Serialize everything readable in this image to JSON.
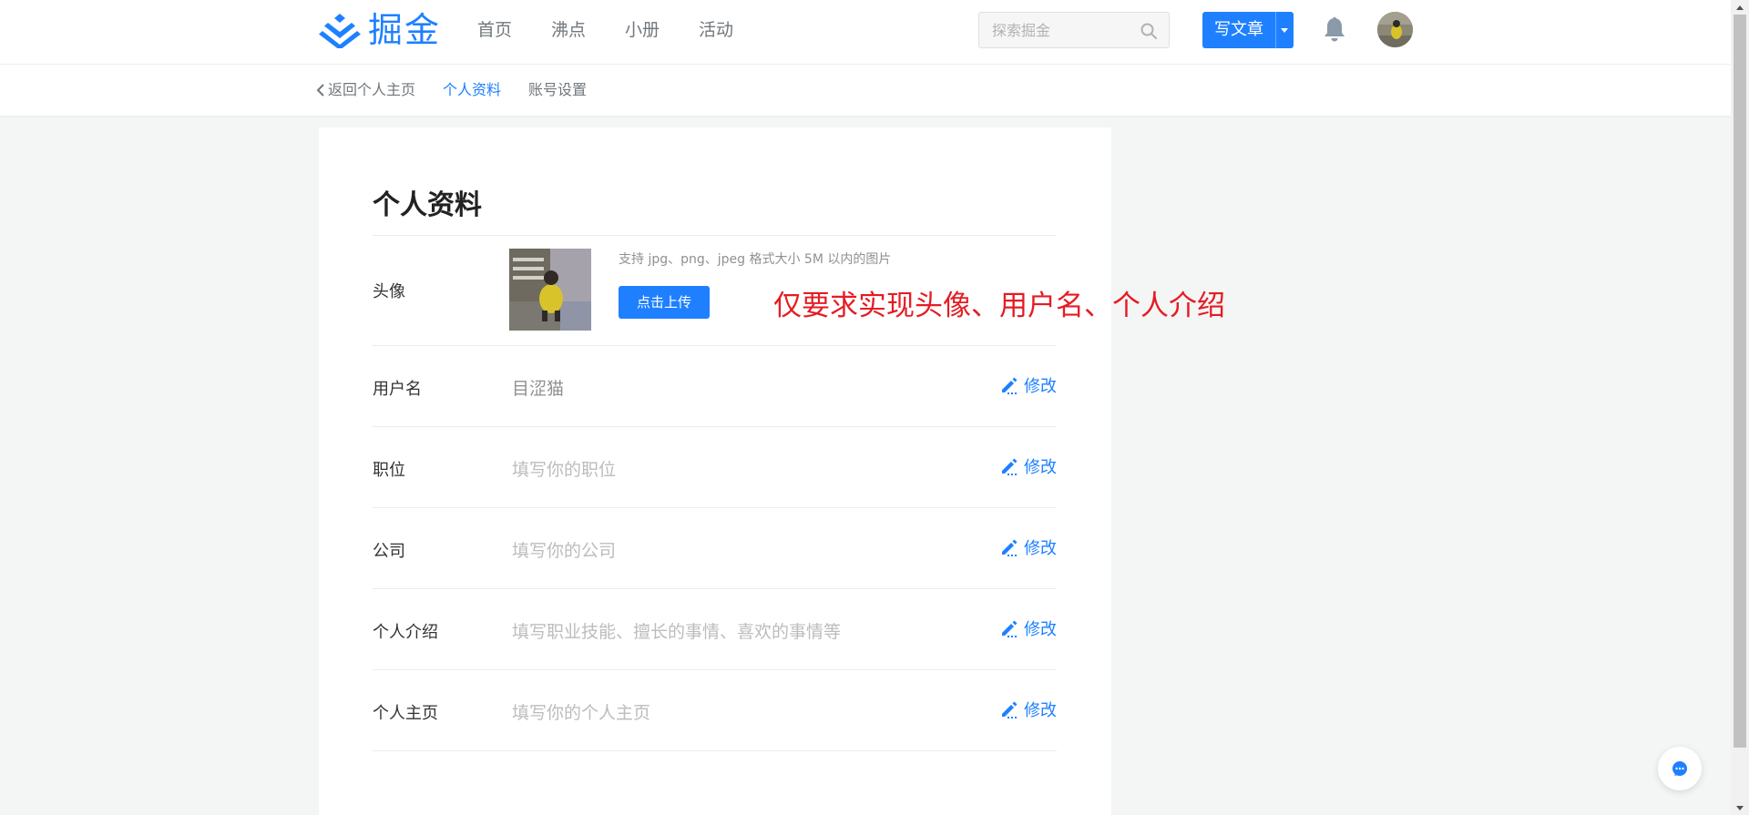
{
  "header": {
    "logo_text": "掘金",
    "nav": [
      "首页",
      "沸点",
      "小册",
      "活动"
    ],
    "search_placeholder": "探索掘金",
    "write_label": "写文章"
  },
  "subnav": {
    "back": "返回个人主页",
    "profile": "个人资料",
    "account": "账号设置"
  },
  "profile": {
    "title": "个人资料",
    "avatar_label": "头像",
    "upload_tip": "支持 jpg、png、jpeg 格式大小 5M 以内的图片",
    "upload_button": "点击上传",
    "rows": [
      {
        "label": "用户名",
        "value": "目涩猫",
        "placeholder": false,
        "action": "修改"
      },
      {
        "label": "职位",
        "value": "填写你的职位",
        "placeholder": true,
        "action": "修改"
      },
      {
        "label": "公司",
        "value": "填写你的公司",
        "placeholder": true,
        "action": "修改"
      },
      {
        "label": "个人介绍",
        "value": "填写职业技能、擅长的事情、喜欢的事情等",
        "placeholder": true,
        "action": "修改"
      },
      {
        "label": "个人主页",
        "value": "填写你的个人主页",
        "placeholder": true,
        "action": "修改"
      }
    ]
  },
  "annotation": "仅要求实现头像、用户名、个人介绍",
  "colors": {
    "accent": "#1e80ff",
    "annotation": "#e51c23",
    "background": "#f4f5f5"
  },
  "icons": [
    "juejin-logo-icon",
    "search-icon",
    "caret-down-icon",
    "bell-icon",
    "chevron-left-icon",
    "pencil-icon",
    "chat-icon"
  ]
}
